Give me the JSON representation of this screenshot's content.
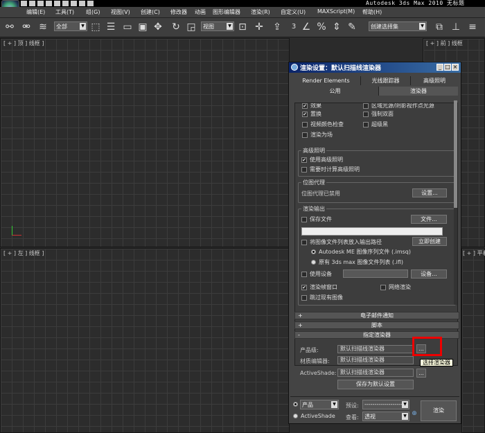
{
  "app": {
    "title": "Autodesk 3ds Max  2010      无标题"
  },
  "menu": [
    "编辑(E)",
    "工具(T)",
    "组(G)",
    "视图(V)",
    "创建(C)",
    "修改器",
    "动画",
    "图形编辑器",
    "渲染(R)",
    "自定义(U)",
    "MAXScript(M)",
    "帮助(H)"
  ],
  "toolbar": {
    "selection_filter": "全部",
    "ref_coord": "视图",
    "named_selection": "创建选择集",
    "snap_label": "3"
  },
  "viewports": {
    "top_label": "[ + ] 顶 ] 线框 ]",
    "front_label": "[ + ] 前 ] 线框",
    "left_label": "[ + ] 左 ] 线框 ]",
    "persp_label": "[ + ] 平着 +"
  },
  "dialog": {
    "title": "渲染设置：默认扫描线渲染器",
    "tabs_row1": [
      "Render Elements",
      "光线跟踪器",
      "高级照明"
    ],
    "tabs_row2": [
      "公用",
      "渲染器"
    ],
    "options": {
      "effects": "效果",
      "displacement": "置换",
      "video_color_check": "视频颜色检查",
      "render_to_fields": "渲染为场",
      "area_lights": "区域光源/阴影视作点光源",
      "force_2sided": "强制双面",
      "super_black": "超级黑"
    },
    "adv_lighting": {
      "title": "高级照明",
      "use": "使用高级照明",
      "compute_when_required": "需要时计算高级照明"
    },
    "bitmap_proxy": {
      "title": "位图代理",
      "status": "位图代理已禁用",
      "setup_btn": "设置..."
    },
    "render_output": {
      "title": "渲染输出",
      "save_file": "保存文件",
      "files_btn": "文件...",
      "put_image_list": "将图像文件列表放入输出路径",
      "create_now_btn": "立即创建",
      "autodesk_me": "Autodesk ME 图像序列文件 (.imsq)",
      "legacy": "原有 3ds max 图像文件列表 (.ifl)",
      "use_device": "使用设备",
      "devices_btn": "设备...",
      "frame_window": "渲染帧窗口",
      "net_render": "网络渲染",
      "skip_existing": "跳过现有图像"
    },
    "rollouts": {
      "email": "电子邮件通知",
      "scripts": "脚本",
      "assign": "指定渲染器"
    },
    "assign": {
      "production_label": "产品级:",
      "production_value": "默认扫描线渲染器",
      "material_label": "材质编辑器:",
      "material_value": "默认扫描线渲染器",
      "activeshade_label": "ActiveShade:",
      "activeshade_value": "默认扫描线渲染器",
      "browse_btn": "...",
      "save_default_btn": "保存为默认设置"
    },
    "bottom": {
      "production_radio": "产品",
      "preset_label": "预设:",
      "preset_value": "--------------------",
      "activeshade_radio": "ActiveShade",
      "view_label": "查看:",
      "view_value": "透视",
      "render_btn": "渲染"
    },
    "tooltip": "选择渲染器"
  }
}
